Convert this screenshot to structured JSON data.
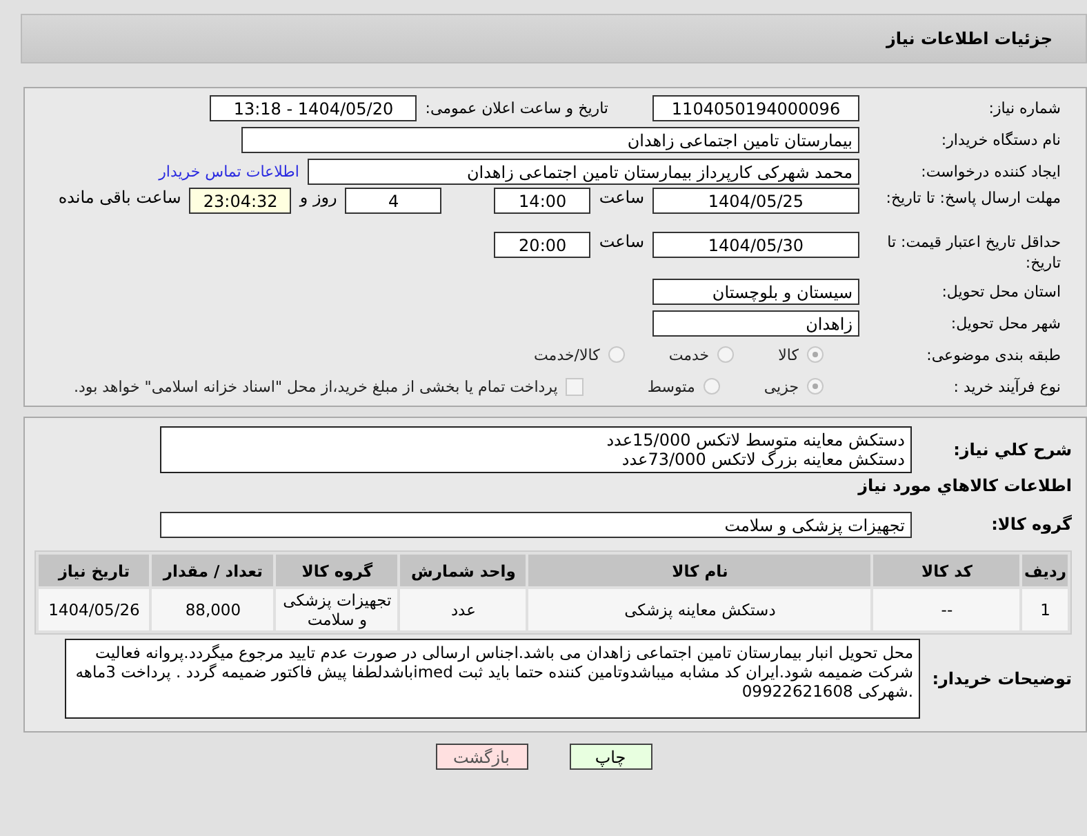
{
  "header": {
    "title": "جزئیات اطلاعات نیاز"
  },
  "need_number": {
    "label": "شماره نیاز:",
    "value": "1104050194000096"
  },
  "announce": {
    "label": "تاریخ و ساعت اعلان عمومی:",
    "value": "1404/05/20 - 13:18"
  },
  "buyer_org": {
    "label": "نام دستگاه خریدار:",
    "value": "بیمارستان تامین اجتماعی زاهدان"
  },
  "requester": {
    "label": "ایجاد کننده درخواست:",
    "value": "محمد شهرکی کارپرداز بیمارستان تامین اجتماعی زاهدان",
    "link": "اطلاعات تماس خریدار"
  },
  "reply_deadline": {
    "label": "مهلت ارسال پاسخ: تا تاریخ:",
    "date": "1404/05/25",
    "time_label": "ساعت",
    "time": "14:00",
    "days": "4",
    "days_label": "روز و",
    "remaining": "23:04:32",
    "remaining_label": "ساعت باقی مانده"
  },
  "price_validity": {
    "label": "حداقل تاریخ اعتبار قیمت: تا تاریخ:",
    "date": "1404/05/30",
    "time_label": "ساعت",
    "time": "20:00"
  },
  "province": {
    "label": "استان محل تحویل:",
    "value": "سیستان و بلوچستان"
  },
  "city": {
    "label": "شهر محل تحویل:",
    "value": "زاهدان"
  },
  "category": {
    "label": "طبقه بندی موضوعی:",
    "options": [
      {
        "label": "کالا",
        "selected": true
      },
      {
        "label": "خدمت",
        "selected": false
      },
      {
        "label": "کالا/خدمت",
        "selected": false
      }
    ]
  },
  "purchase_type": {
    "label": "نوع فرآیند خرید :",
    "options": [
      {
        "label": "جزیی",
        "selected": true
      },
      {
        "label": "متوسط",
        "selected": false
      }
    ],
    "payment_note": {
      "label": "پرداخت تمام یا بخشی از مبلغ خرید،از محل \"اسناد خزانه اسلامی\" خواهد بود.",
      "checked": false
    }
  },
  "description": {
    "label": "شرح کلي نياز:",
    "lines": [
      "دستکش معاینه متوسط لاتکس 15/000عدد",
      "دستکش معاینه بزرگ لاتکس 73/000عدد"
    ]
  },
  "goods_heading": "اطلاعات کالاهاي مورد نياز",
  "goods_group": {
    "label": "گروه کالا:",
    "value": "تجهیزات پزشکی و سلامت"
  },
  "table": {
    "columns": [
      "ردیف",
      "کد کالا",
      "نام کالا",
      "واحد شمارش",
      "گروه کالا",
      "تعداد / مقدار",
      "تاریخ نیاز"
    ],
    "rows": [
      {
        "cells": [
          "1",
          "--",
          "دستکش معاینه پزشکی",
          "عدد",
          "تجهیزات پزشکی و سلامت",
          "88,000",
          "1404/05/26"
        ]
      }
    ]
  },
  "buyer_notes": {
    "label": "توضیحات خریدار:",
    "value": "محل تحویل انبار بیمارستان تامین اجتماعی زاهدان می باشد.اجناس ارسالی در صورت عدم تایید مرجوع میگردد.پروانه فعالیت شرکت ضمیمه شود.ایران کد مشابه میباشدوتامین کننده حتما باید ثبت imedباشدلطفا پیش فاکتور ضمیمه گردد . پرداخت 3ماهه  .شهرکی 09922621608"
  },
  "buttons": [
    {
      "label": "چاپ",
      "kind": "print"
    },
    {
      "label": "بازگشت",
      "kind": "back"
    }
  ]
}
